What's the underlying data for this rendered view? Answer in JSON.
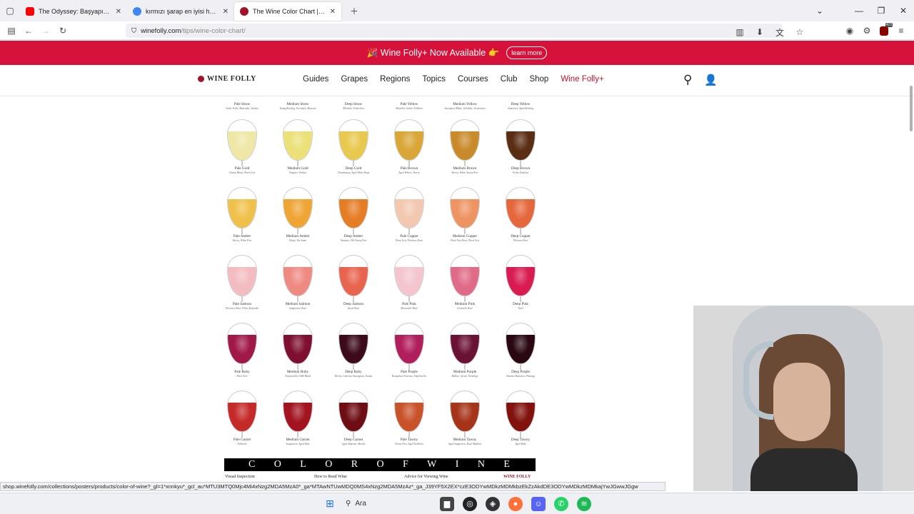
{
  "browser": {
    "tabs": [
      {
        "title": "The Odyssey: Başyapıt mı, Fiyasko",
        "favicon_color": "#ff0000"
      },
      {
        "title": "kırmızı şarap en iyisi hangisi - G",
        "favicon_color": "#4285f4"
      },
      {
        "title": "The Wine Color Chart | Wine Fo",
        "favicon_color": "#a3122a"
      }
    ],
    "url_domain": "winefolly.com",
    "url_path": "/tips/wine-color-chart/",
    "status_url": "shop.winefolly.com/collections/posters/products/color-of-wine?_gl=1*xnnkyu*_gcl_au*MTU3MTQ0Mjc4Mi4xNzg2MDA5MzA0*_ga*MTAwNTUwMDQ0MS4xNzg2MDA5MzAz*_ga_J39YF5X2EX*czE3ODYwMDkzMDMkbzEkZzAkdDE3ODYwMDkzMDMkajYwJGwwJGgw",
    "extension_badge": "423"
  },
  "promo": {
    "text": "🎉 Wine Folly+ Now Available 👉",
    "button": "learn more"
  },
  "site": {
    "logo": "WINE FOLLY",
    "nav": [
      "Guides",
      "Grapes",
      "Regions",
      "Topics",
      "Courses",
      "Club",
      "Shop",
      "Wine Folly+"
    ]
  },
  "chart": {
    "top_row": [
      {
        "name": "Pale Straw",
        "sub": "Vinho Verde, Muscadet, Verdejo"
      },
      {
        "name": "Medium Straw",
        "sub": "Young Riesling, Torrontés, Muscato"
      },
      {
        "name": "Deep Straw",
        "sub": "Albariño, Verdicchio"
      },
      {
        "name": "Pale Yellow",
        "sub": "Albariño, Grüner Veltliner"
      },
      {
        "name": "Medium Yellow",
        "sub": "Sauvignon Blanc, Sémillon, Vermentino"
      },
      {
        "name": "Deep Yellow",
        "sub": "Sauternes, Aged Riesling"
      }
    ],
    "rows": [
      [
        {
          "name": "Pale Gold",
          "sub": "Chenin Blanc, Pinot Gris",
          "color": "#eee7a6"
        },
        {
          "name": "Medium Gold",
          "sub": "Viognier, Verdejo",
          "color": "#ece078"
        },
        {
          "name": "Deep Gold",
          "sub": "Chardonnay, Aged White Rioja",
          "color": "#e8c84e"
        },
        {
          "name": "Pale Brown",
          "sub": "Aged Whites, Sherry",
          "color": "#d9a637"
        },
        {
          "name": "Medium Brown",
          "sub": "Sherry, White Tawny Port",
          "color": "#c98a2a"
        },
        {
          "name": "Deep Brown",
          "sub": "Pedro Ximénez",
          "color": "#5a2e14"
        }
      ],
      [
        {
          "name": "Pale Amber",
          "sub": "Sherry, White Port",
          "color": "#f0c14a"
        },
        {
          "name": "Medium Amber",
          "sub": "Tokaji, Vin Santo",
          "color": "#eea534"
        },
        {
          "name": "Deep Amber",
          "sub": "Vinsanto, Old Tawny Port",
          "color": "#e57d25"
        },
        {
          "name": "Pale Copper",
          "sub": "Pinot Gris, Provence Rosé",
          "color": "#f2c8b0"
        },
        {
          "name": "Medium Copper",
          "sub": "Pinot Noir Rosé, Pinot Gris",
          "color": "#ee9462"
        },
        {
          "name": "Deep Copper",
          "sub": "Tibouren Rosé",
          "color": "#e5683c"
        }
      ],
      [
        {
          "name": "Pale Salmon",
          "sub": "Provence Rosé, White Zinfandel",
          "color": "#f3bcc0"
        },
        {
          "name": "Medium Salmon",
          "sub": "Sangiovese Rosé",
          "color": "#ee8a82"
        },
        {
          "name": "Deep Salmon",
          "sub": "Syrah Rosé",
          "color": "#e8644f"
        },
        {
          "name": "Pale Pink",
          "sub": "Mourvèdre Rosé",
          "color": "#f4c5cf"
        },
        {
          "name": "Medium Pink",
          "sub": "Grenache Rosé",
          "color": "#e06b88"
        },
        {
          "name": "Deep Pink",
          "sub": "Tavel",
          "color": "#d81c52"
        }
      ],
      [
        {
          "name": "Pale Ruby",
          "sub": "Pinot Noir",
          "color": "#a01848"
        },
        {
          "name": "Medium Ruby",
          "sub": "Tempranillo, GSM Blend",
          "color": "#7e0f30"
        },
        {
          "name": "Deep Ruby",
          "sub": "Merlot, Cabernet Sauvignon, Tannat",
          "color": "#3c0a1a"
        },
        {
          "name": "Pale Purple",
          "sub": "Beaujolais Nouveau, Valpolicella",
          "color": "#b01e5c"
        },
        {
          "name": "Medium Purple",
          "sub": "Malbec, Syrah, Teroldego",
          "color": "#6a1234"
        },
        {
          "name": "Deep Purple",
          "sub": "Alicante Bouschet, Pinotage",
          "color": "#2a0812"
        }
      ],
      [
        {
          "name": "Pale Garnet",
          "sub": "Nebbiolo",
          "color": "#c42a28"
        },
        {
          "name": "Medium Garnet",
          "sub": "Sangiovese, Aged Reds",
          "color": "#a11420"
        },
        {
          "name": "Deep Garnet",
          "sub": "Aged Amarone, Barolo",
          "color": "#6e0e14"
        },
        {
          "name": "Pale Tawny",
          "sub": "Tawny Port, Aged Nebbiolo",
          "color": "#c8532a"
        },
        {
          "name": "Medium Tawny",
          "sub": "Aged Sangiovese, Rosé Madeira",
          "color": "#a53418"
        },
        {
          "name": "Deep Tawny",
          "sub": "Aged Reds",
          "color": "#82120e"
        }
      ]
    ],
    "banner_letters": [
      "C",
      "O",
      "L",
      "O",
      "R",
      "O",
      "F",
      "W",
      "I",
      "N",
      "E"
    ],
    "below": [
      "Visual Inspection",
      "How to Read Wine",
      "Advice for Viewing Wine",
      "WINE FOLLY"
    ]
  },
  "taskbar": {
    "search": "Ara"
  }
}
